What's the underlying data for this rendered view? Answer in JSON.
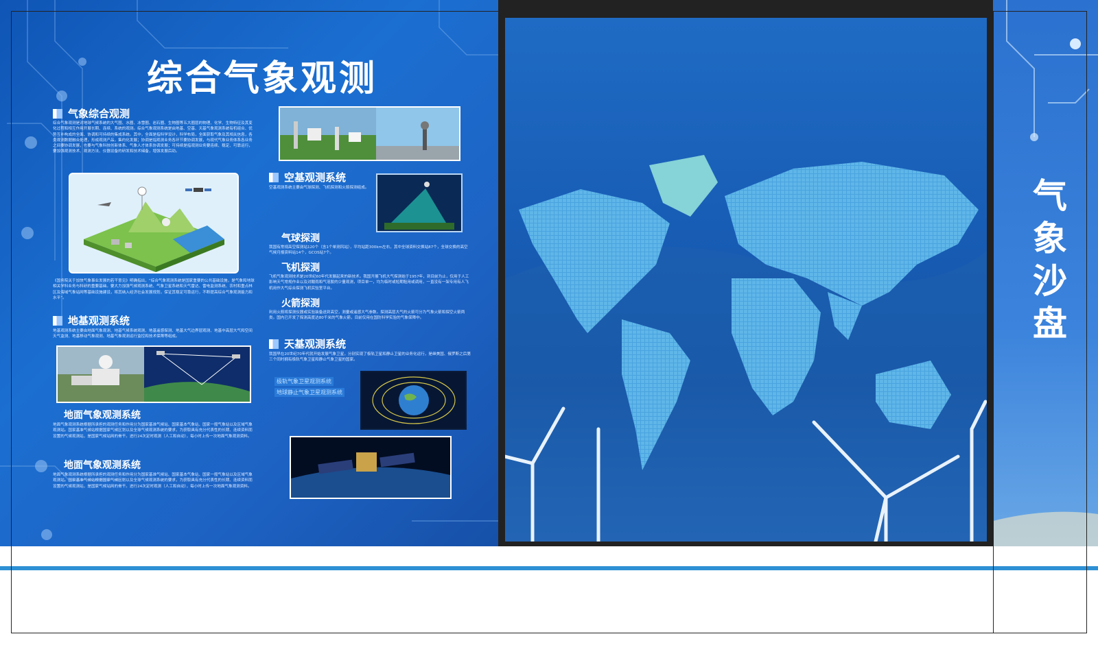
{
  "main_title": "综合气象观测",
  "side_title": [
    "气",
    "象",
    "沙",
    "盘"
  ],
  "sections": {
    "integrated": {
      "heading": "气象综合观测",
      "text": "综合气象观测是对地球气候系统的大气圈、水圈、冰雪圈、岩石圈、生物圈等五大圈层的物理、化学、生物特征及其变化过程和相互作用开展长期、连续、系统的观测。综合气象观测系统是由地基、空基、天基气象观测系统有机组合、优势互补构成的全面、协调和可持续的集成系统。其中，全面是指科学设计，科学布局，全面获取气象及其相关信息，各类观测数据融合处理，形成观测产品，集约化发展；协调是指观测业务各环节要协调发展，与现代气象业务体系各业务之间要协调发展，也要与气象科技创新体系、气象人才体系协调发展；可持续是指观测业务要连续、稳定、可靠运行，要加强观测技术、观测方法、仪器设备的研发和技术储备，增强发展后劲。",
      "quote": "《国务院关于加快气象事业发展的若干意见》明确指出，“综合气象观测系统是国家重要的公共基础设施，是气象和地球相关学科业务与科研的重要基础。要大力加强气候观测系统、气象卫星系统和天气雷达、雷电监测系统、农村和重点林区及海域气象站网等基础设施建设，将其纳入经济社会发展规划，保证其稳定可靠运行，不断提高综合气象观测能力和水平”。"
    },
    "ground": {
      "heading": "地基观测系统",
      "text": "地基观测系统主要由地面气象观测、地基气候系统观测、地基遥感探测、地基大气边界层观测、地基中高层大气和空间天气监测、地基移动气象观测、地基气象观测运行监控和技术保障等组成。",
      "sub1": {
        "heading": "地面气象观测系统",
        "text": "地面气象观测系统根据所承担的观测任务和作用分为国家基准气候站、国家基本气象站、国家一般气象站以及区域气象观测站。国家基准气候站根据国家气候区划以及全球气候观测系统的要求，为获取具有充分代表性的长期、连续资料而设置的气候观测站，是国家气候站网的骨干。进行24次定时观测（人工和自动），每小时上传一次地面气象观测资料。"
      },
      "sub2": {
        "heading": "地面气象观测系统",
        "text": "地面气象观测系统根据所承担的观测任务和作用分为国家基准气候站、国家基本气象站、国家一般气象站以及区域气象观测站。国家基准气候站根据国家气候区划以及全球气候观测系统的要求，为获取具有充分代表性的长期、连续资料而设置的气候观测站，是国家气候站网的骨干。进行24次定时观测（人工和自动），每小时上传一次地面气象观测资料。"
      }
    },
    "air": {
      "heading": "空基观测系统",
      "text": "空基观测系统主要由气球探测、飞机探测和火箭探测组成。",
      "balloon": {
        "heading": "气球探测",
        "text": "我国有常规高空探测站120个（含1个单测风站），平均站距300km左右，其中全球资料交换站87个，全球交换的高空气候月报资料站14个，GCOS站7个。"
      },
      "aircraft": {
        "heading": "飞机探测",
        "text": "飞机气象观测技术是20世纪60年代发展起来的新技术。我国开展飞机大气探测始于1957年，到目前为止，仅用于人工影响天气常规作业以及对酸雨和气溶胶的少量观测，项目单一，均为临时或短期租用或调用，一直没有一架专用有人飞机用作大气综合探测飞机实验室平台。"
      },
      "rocket": {
        "heading": "火箭探测",
        "text": "利用火箭将探测仪器或实验装备送到高空，测量或遥感大气参数。探测高层大气的火箭可分为气象火箭和探空火箭两类。国内已开发了探测高度达80千米的气象火箭，目前仅用在国防科学实验的气象保障中。"
      }
    },
    "space": {
      "heading": "天基观测系统",
      "text": "我国早在20世纪70年代就开始发展气象卫星，分别实现了极轨卫星和静止卫星的业务化运行，是继美国、俄罗斯之后第三个同时拥有极轨气象卫星和静止气象卫星的国家。",
      "link1": "极轨气象卫星观测系统",
      "link2": "地球静止气象卫星观测系统"
    }
  },
  "colors": {
    "panel_blue": "#1b6fd1",
    "accent_line": "#2e90d4",
    "map_land": "#5fb6e8"
  }
}
